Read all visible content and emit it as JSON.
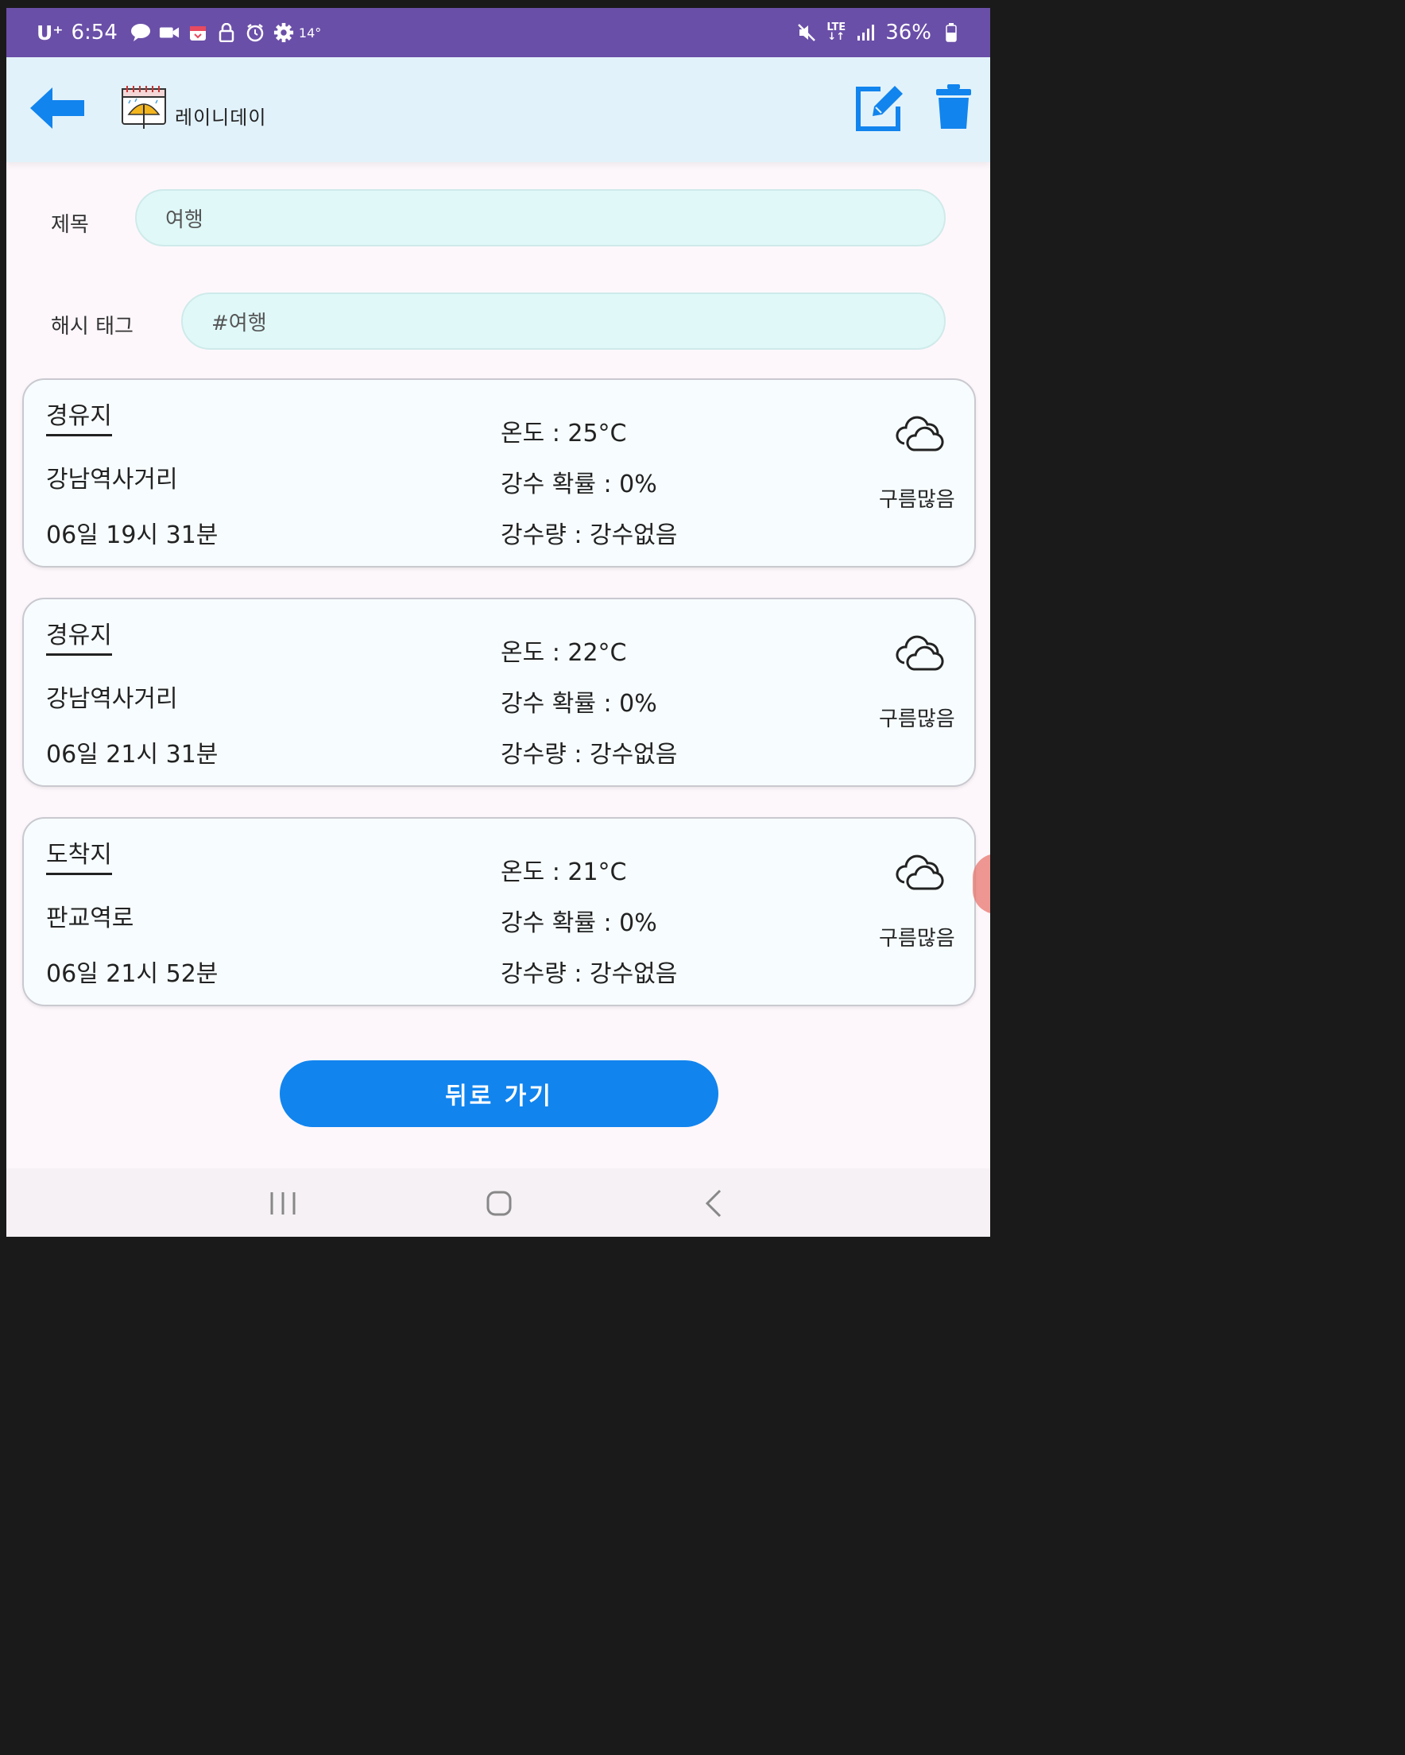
{
  "status_bar": {
    "carrier": "U⁺",
    "time": "6:54",
    "temperature": "14°",
    "battery": "36%"
  },
  "header": {
    "app_name": "레이니데이",
    "icons": [
      "back-arrow-icon",
      "umbrella-calendar-logo",
      "edit-icon",
      "trash-icon"
    ],
    "accent_color": "#1184ee"
  },
  "form": {
    "title_label": "제목",
    "title_value": "여행",
    "hashtag_label": "해시 태그",
    "hashtag_value": "#여행"
  },
  "cards": [
    {
      "type": "경유지",
      "place": "강남역사거리",
      "time": "06일 19시 31분",
      "temperature": "온도 : 25°C",
      "rain_probability": "강수 확률 : 0%",
      "rainfall": "강수량 : 강수없음",
      "condition": "구름많음",
      "icon": "cloud-icon"
    },
    {
      "type": "경유지",
      "place": "강남역사거리",
      "time": "06일 21시 31분",
      "temperature": "온도 : 22°C",
      "rain_probability": "강수 확률 : 0%",
      "rainfall": "강수량 : 강수없음",
      "condition": "구름많음",
      "icon": "cloud-icon"
    },
    {
      "type": "도착지",
      "place": "판교역로",
      "time": "06일 21시 52분",
      "temperature": "온도 : 21°C",
      "rain_probability": "강수 확률 : 0%",
      "rainfall": "강수량 : 강수없음",
      "condition": "구름많음",
      "icon": "cloud-icon"
    }
  ],
  "footer": {
    "back_button_label": "뒤로 가기"
  }
}
